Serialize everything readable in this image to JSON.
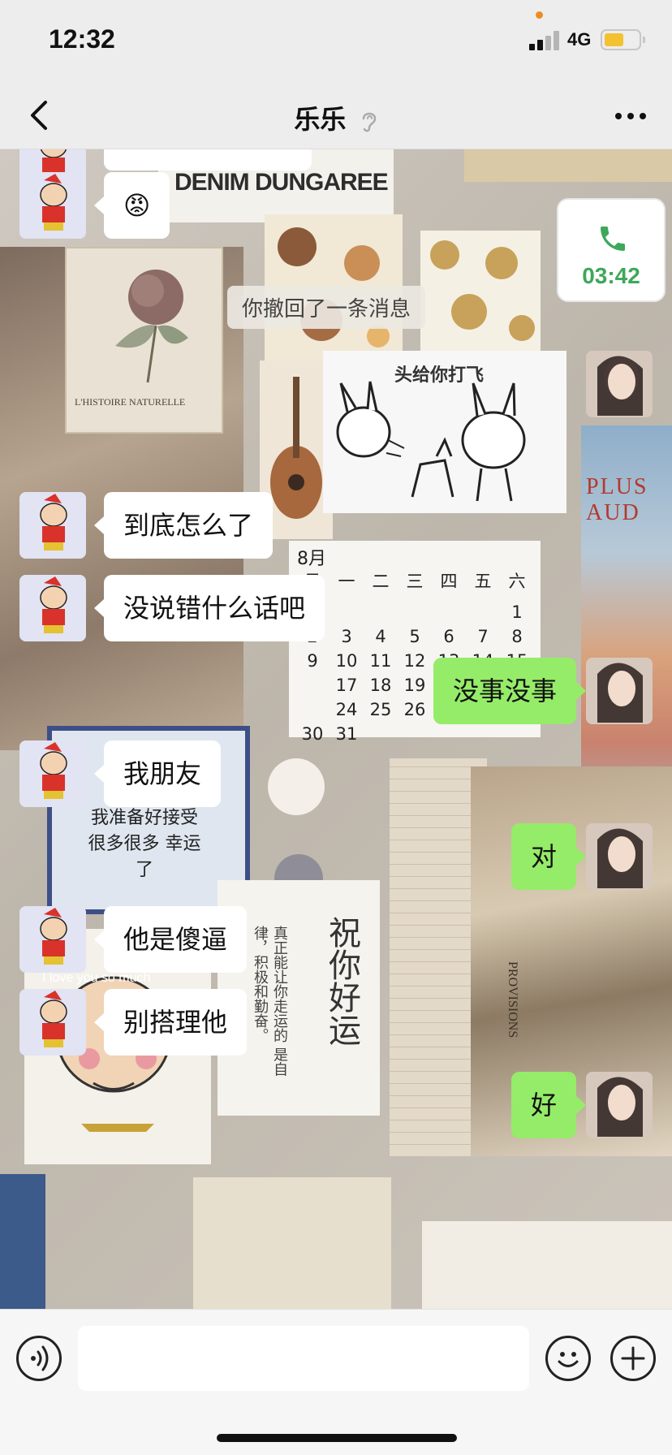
{
  "status_bar": {
    "time": "12:32",
    "network": "4G",
    "battery_level": 0.58,
    "signal_bars": 2
  },
  "header": {
    "title": "乐乐"
  },
  "chat": {
    "call": {
      "duration": "03:42"
    },
    "system_notice": "你撤回了一条消息",
    "sticker": {
      "caption": "头给你打飞"
    },
    "emoji_message": "😡",
    "messages": [
      {
        "side": "in",
        "text": "到底怎么了"
      },
      {
        "side": "in",
        "text": "没说错什么话吧"
      },
      {
        "side": "out",
        "text": "没事没事"
      },
      {
        "side": "in",
        "text": "我朋友"
      },
      {
        "side": "out",
        "text": "对"
      },
      {
        "side": "in",
        "text": "他是傻逼"
      },
      {
        "side": "in",
        "text": "别搭理他"
      },
      {
        "side": "out",
        "text": "好"
      }
    ]
  },
  "background": {
    "denim_card": "DENIM DUNGAREE",
    "botanical_card": "L'HISTOIRE NATURELLE",
    "calendar": {
      "month": "8月",
      "weekdays": [
        "日",
        "一",
        "二",
        "三",
        "四",
        "五",
        "六"
      ],
      "rows": [
        [
          "",
          "",
          "",
          "",
          "",
          "",
          "1"
        ],
        [
          "2",
          "3",
          "4",
          "5",
          "6",
          "7",
          "8"
        ],
        [
          "9",
          "10",
          "11",
          "12",
          "13",
          "14",
          "15"
        ],
        [
          "",
          "17",
          "18",
          "19",
          "20",
          "21",
          "22"
        ],
        [
          "",
          "24",
          "25",
          "26",
          "27",
          "28",
          "29"
        ],
        [
          "30",
          "31",
          "",
          "",
          "",
          "",
          ""
        ]
      ]
    },
    "note_card": "我准备好接受 很多很多 幸运了",
    "luck_card_title": "祝你好运",
    "luck_card_body": "真正能让你走运的 是自律，积极和勤奋。",
    "love_text": "I love you so much",
    "plus_card": "PLUS AUD",
    "provisions_text": "PROVISIONS"
  },
  "input": {
    "placeholder": ""
  },
  "colors": {
    "incoming_bubble": "#ffffff",
    "outgoing_bubble": "#95ec69",
    "call_green": "#3ea85a"
  }
}
